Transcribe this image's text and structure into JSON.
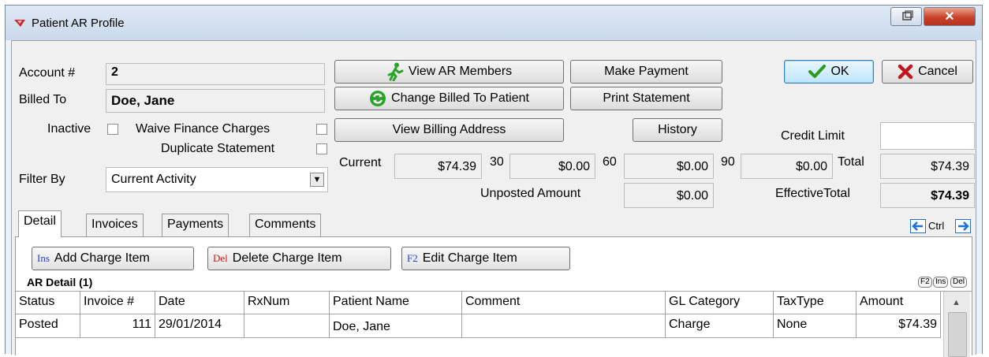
{
  "window": {
    "title": "Patient AR Profile"
  },
  "account": {
    "account_label": "Account #",
    "account_value": "2",
    "billed_to_label": "Billed To",
    "billed_to_value": "Doe, Jane",
    "inactive_label": "Inactive",
    "waive_label": "Waive Finance Charges",
    "duplicate_label": "Duplicate Statement",
    "filter_label": "Filter By",
    "filter_value": "Current Activity"
  },
  "buttons": {
    "view_ar_members": "View AR Members",
    "change_billed_to": "Change Billed To Patient",
    "view_billing_address": "View Billing Address",
    "make_payment": "Make Payment",
    "print_statement": "Print Statement",
    "history": "History",
    "ok": "OK",
    "cancel": "Cancel"
  },
  "balances": {
    "current_label": "Current",
    "current_value": "$74.39",
    "d30_label": "30",
    "d30_value": "$0.00",
    "d60_label": "60",
    "d60_value": "$0.00",
    "d90_label": "90",
    "d90_value": "$0.00",
    "total_label": "Total",
    "total_value": "$74.39",
    "unposted_label": "Unposted Amount",
    "unposted_value": "$0.00",
    "effective_label": "EffectiveTotal",
    "effective_value": "$74.39",
    "credit_limit_label": "Credit Limit",
    "credit_limit_value": ""
  },
  "tabs": [
    {
      "label": "Detail"
    },
    {
      "label": "Invoices"
    },
    {
      "label": "Payments"
    },
    {
      "label": "Comments"
    }
  ],
  "nav": {
    "ctrl_label": "Ctrl"
  },
  "detail": {
    "add_key": "Ins",
    "add_label": "Add Charge Item",
    "delete_key": "Del",
    "delete_label": "Delete Charge Item",
    "edit_key": "F2",
    "edit_label": "Edit Charge Item",
    "section_title": "AR Detail (1)",
    "mini_keys": [
      "F2",
      "Ins",
      "Del"
    ],
    "columns": [
      "Status",
      "Invoice #",
      "Date",
      "RxNum",
      "Patient Name",
      "Comment",
      "GL Category",
      "TaxType",
      "Amount"
    ],
    "rows": [
      {
        "status": "Posted",
        "invoice": "111",
        "date": "29/01/2014",
        "rxnum": "",
        "patient": "Doe, Jane",
        "comment": "",
        "gl": "Charge",
        "tax": "None",
        "amount": "$74.39"
      }
    ]
  },
  "colors": {
    "ok_check": "#2d9a1f",
    "cancel_x": "#c0181e",
    "refresh_green": "#2aa32a",
    "nav_blue": "#1f6fd8"
  }
}
